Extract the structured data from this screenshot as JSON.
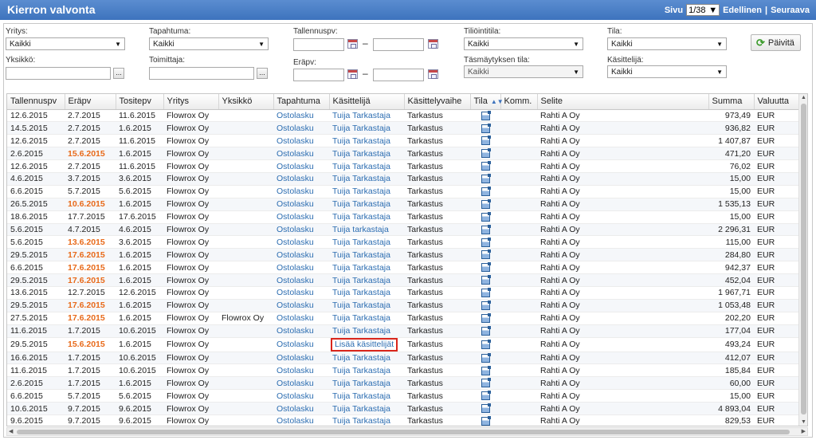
{
  "header": {
    "title": "Kierron valvonta",
    "page_label": "Sivu",
    "page_value": "1/38",
    "prev_label": "Edellinen",
    "separator": "|",
    "next_label": "Seuraava"
  },
  "filters": {
    "yritys": {
      "label": "Yritys:",
      "value": "Kaikki"
    },
    "tapahtuma": {
      "label": "Tapahtuma:",
      "value": "Kaikki"
    },
    "tallennuspv": {
      "label": "Tallennuspv:",
      "dash": "–"
    },
    "tiliointitila": {
      "label": "Tiliöintitila:",
      "value": "Kaikki"
    },
    "tila": {
      "label": "Tila:",
      "value": "Kaikki"
    },
    "yksikko": {
      "label": "Yksikkö:",
      "button": "..."
    },
    "toimittaja": {
      "label": "Toimittaja:",
      "button": "..."
    },
    "erapv": {
      "label": "Eräpv:",
      "dash": "–"
    },
    "tasmaytys": {
      "label": "Täsmäytyksen tila:",
      "value": "Kaikki"
    },
    "kasittelija": {
      "label": "Käsittelijä:",
      "value": "Kaikki"
    },
    "refresh_label": "Päivitä"
  },
  "table": {
    "columns": [
      "Tallennuspv",
      "Eräpv",
      "Tositepv",
      "Yritys",
      "Yksikkö",
      "Tapahtuma",
      "Käsittelijä",
      "Käsittelyvaihe",
      "Tila",
      "Komm.",
      "Selite",
      "Summa",
      "Valuutta"
    ],
    "rows": [
      [
        "12.6.2015",
        "2.7.2015",
        "11.6.2015",
        "Flowrox Oy",
        "",
        "Ostolasku",
        "Tuija Tarkastaja",
        "Tarkastus",
        "",
        "Rahti A Oy",
        "973,49",
        "EUR"
      ],
      [
        "14.5.2015",
        "2.7.2015",
        "1.6.2015",
        "Flowrox Oy",
        "",
        "Ostolasku",
        "Tuija Tarkastaja",
        "Tarkastus",
        "",
        "Rahti A Oy",
        "936,82",
        "EUR"
      ],
      [
        "12.6.2015",
        "2.7.2015",
        "11.6.2015",
        "Flowrox Oy",
        "",
        "Ostolasku",
        "Tuija Tarkastaja",
        "Tarkastus",
        "",
        "Rahti A Oy",
        "1 407,87",
        "EUR"
      ],
      [
        "2.6.2015",
        "15.6.2015",
        "1.6.2015",
        "Flowrox Oy",
        "",
        "Ostolasku",
        "Tuija Tarkastaja",
        "Tarkastus",
        "",
        "Rahti A Oy",
        "471,20",
        "EUR"
      ],
      [
        "12.6.2015",
        "2.7.2015",
        "11.6.2015",
        "Flowrox Oy",
        "",
        "Ostolasku",
        "Tuija Tarkastaja",
        "Tarkastus",
        "",
        "Rahti A Oy",
        "76,02",
        "EUR"
      ],
      [
        "4.6.2015",
        "3.7.2015",
        "3.6.2015",
        "Flowrox Oy",
        "",
        "Ostolasku",
        "Tuija Tarkastaja",
        "Tarkastus",
        "",
        "Rahti A Oy",
        "15,00",
        "EUR"
      ],
      [
        "6.6.2015",
        "5.7.2015",
        "5.6.2015",
        "Flowrox Oy",
        "",
        "Ostolasku",
        "Tuija Tarkastaja",
        "Tarkastus",
        "",
        "Rahti A Oy",
        "15,00",
        "EUR"
      ],
      [
        "26.5.2015",
        "10.6.2015",
        "1.6.2015",
        "Flowrox Oy",
        "",
        "Ostolasku",
        "Tuija Tarkastaja",
        "Tarkastus",
        "",
        "Rahti A Oy",
        "1 535,13",
        "EUR"
      ],
      [
        "18.6.2015",
        "17.7.2015",
        "17.6.2015",
        "Flowrox Oy",
        "",
        "Ostolasku",
        "Tuija Tarkastaja",
        "Tarkastus",
        "",
        "Rahti A Oy",
        "15,00",
        "EUR"
      ],
      [
        "5.6.2015",
        "4.7.2015",
        "4.6.2015",
        "Flowrox Oy",
        "",
        "Ostolasku",
        "Tuija tarkastaja",
        "Tarkastus",
        "",
        "Rahti A Oy",
        "2 296,31",
        "EUR"
      ],
      [
        "5.6.2015",
        "13.6.2015",
        "3.6.2015",
        "Flowrox Oy",
        "",
        "Ostolasku",
        "Tuija Tarkastaja",
        "Tarkastus",
        "",
        "Rahti A Oy",
        "115,00",
        "EUR"
      ],
      [
        "29.5.2015",
        "17.6.2015",
        "1.6.2015",
        "Flowrox Oy",
        "",
        "Ostolasku",
        "Tuija Tarkastaja",
        "Tarkastus",
        "",
        "Rahti A Oy",
        "284,80",
        "EUR"
      ],
      [
        "6.6.2015",
        "17.6.2015",
        "1.6.2015",
        "Flowrox Oy",
        "",
        "Ostolasku",
        "Tuija Tarkastaja",
        "Tarkastus",
        "",
        "Rahti A Oy",
        "942,37",
        "EUR"
      ],
      [
        "29.5.2015",
        "17.6.2015",
        "1.6.2015",
        "Flowrox Oy",
        "",
        "Ostolasku",
        "Tuija Tarkastaja",
        "Tarkastus",
        "",
        "Rahti A Oy",
        "452,04",
        "EUR"
      ],
      [
        "13.6.2015",
        "12.7.2015",
        "12.6.2015",
        "Flowrox Oy",
        "",
        "Ostolasku",
        "Tuija Tarkastaja",
        "Tarkastus",
        "",
        "Rahti A Oy",
        "1 967,71",
        "EUR"
      ],
      [
        "29.5.2015",
        "17.6.2015",
        "1.6.2015",
        "Flowrox Oy",
        "",
        "Ostolasku",
        "Tuija Tarkastaja",
        "Tarkastus",
        "",
        "Rahti A Oy",
        "1 053,48",
        "EUR"
      ],
      [
        "27.5.2015",
        "17.6.2015",
        "1.6.2015",
        "Flowrox Oy",
        "Flowrox Oy",
        "Ostolasku",
        "Tuija Tarkastaja",
        "Tarkastus",
        "",
        "Rahti A Oy",
        "202,20",
        "EUR"
      ],
      [
        "11.6.2015",
        "1.7.2015",
        "10.6.2015",
        "Flowrox Oy",
        "",
        "Ostolasku",
        "Tuija Tarkastaja",
        "Tarkastus",
        "",
        "Rahti A Oy",
        "177,04",
        "EUR"
      ],
      [
        "29.5.2015",
        "15.6.2015",
        "1.6.2015",
        "Flowrox Oy",
        "",
        "Ostolasku",
        "Lisää käsittelijät",
        "Tarkastus",
        "",
        "Rahti A Oy",
        "493,24",
        "EUR"
      ],
      [
        "16.6.2015",
        "1.7.2015",
        "10.6.2015",
        "Flowrox Oy",
        "",
        "Ostolasku",
        "Tuija Tarkastaja",
        "Tarkastus",
        "",
        "Rahti A Oy",
        "412,07",
        "EUR"
      ],
      [
        "11.6.2015",
        "1.7.2015",
        "10.6.2015",
        "Flowrox Oy",
        "",
        "Ostolasku",
        "Tuija Tarkastaja",
        "Tarkastus",
        "",
        "Rahti A Oy",
        "185,84",
        "EUR"
      ],
      [
        "2.6.2015",
        "1.7.2015",
        "1.6.2015",
        "Flowrox Oy",
        "",
        "Ostolasku",
        "Tuija Tarkastaja",
        "Tarkastus",
        "",
        "Rahti A Oy",
        "60,00",
        "EUR"
      ],
      [
        "6.6.2015",
        "5.7.2015",
        "5.6.2015",
        "Flowrox Oy",
        "",
        "Ostolasku",
        "Tuija Tarkastaja",
        "Tarkastus",
        "",
        "Rahti A Oy",
        "15,00",
        "EUR"
      ],
      [
        "10.6.2015",
        "9.7.2015",
        "9.6.2015",
        "Flowrox Oy",
        "",
        "Ostolasku",
        "Tuija Tarkastaja",
        "Tarkastus",
        "",
        "Rahti A Oy",
        "4 893,04",
        "EUR"
      ],
      [
        "9.6.2015",
        "9.7.2015",
        "9.6.2015",
        "Flowrox Oy",
        "",
        "Ostolasku",
        "Tuija Tarkastaja",
        "Tarkastus",
        "",
        "Rahti A Oy",
        "829,53",
        "EUR"
      ]
    ],
    "overdue_rows": [
      3,
      7,
      10,
      11,
      12,
      13,
      15,
      16,
      18
    ],
    "highlighted_cell": {
      "row": 18,
      "text": "Lisää käsittelijät",
      "color": "#d9261c"
    },
    "overdue_color": "#e86a1a",
    "link_color": "#2c6db1",
    "status_icon": "edit-document-icon"
  }
}
